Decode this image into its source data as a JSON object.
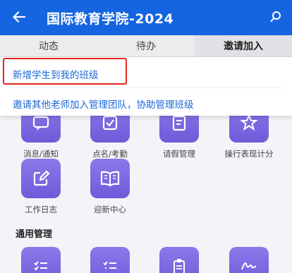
{
  "header": {
    "title": "国际教育学院-2024"
  },
  "tabs": [
    {
      "label": "动态"
    },
    {
      "label": "待办"
    },
    {
      "label": "邀请加入"
    }
  ],
  "dropdown": {
    "items": [
      {
        "label": "新增学生到我的班级"
      },
      {
        "label": "邀请其他老师加入管理团队，协助管理班级"
      }
    ]
  },
  "grid": {
    "row1": [
      {
        "label": "消息/通知"
      },
      {
        "label": "点名/考勤"
      },
      {
        "label": "请假管理"
      },
      {
        "label": "操行表现计分"
      }
    ],
    "row2": [
      {
        "label": "工作日志"
      },
      {
        "label": "迎新中心"
      }
    ]
  },
  "section": {
    "title": "通用管理"
  },
  "colors": {
    "header": "#1565e0",
    "accent": "#1a66d8",
    "icon_gradient": "#7c68e2",
    "highlight": "#e5261f"
  }
}
